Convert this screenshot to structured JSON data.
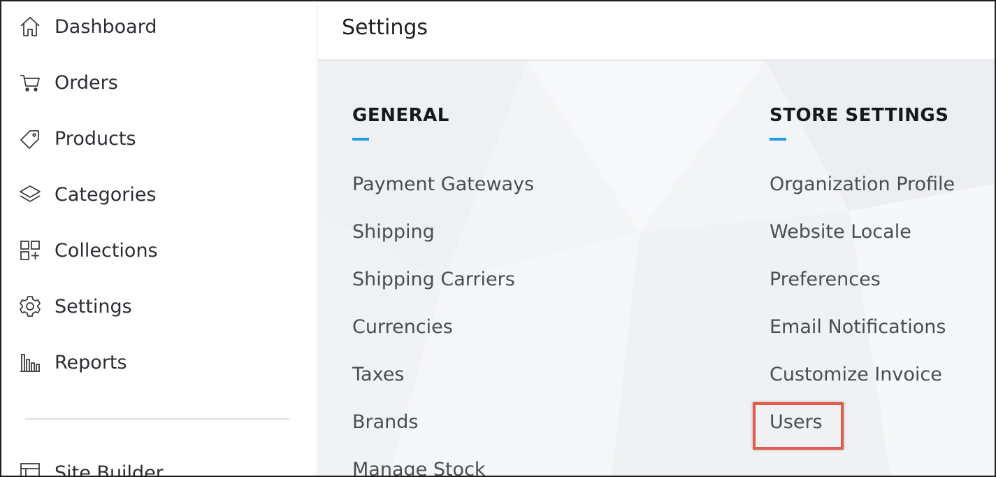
{
  "sidebar": {
    "items": [
      {
        "label": "Dashboard",
        "icon": "home-icon"
      },
      {
        "label": "Orders",
        "icon": "cart-icon"
      },
      {
        "label": "Products",
        "icon": "tag-icon"
      },
      {
        "label": "Categories",
        "icon": "layers-icon"
      },
      {
        "label": "Collections",
        "icon": "grid-plus-icon"
      },
      {
        "label": "Settings",
        "icon": "gear-icon"
      },
      {
        "label": "Reports",
        "icon": "bar-chart-icon"
      },
      {
        "label": "Site Builder",
        "icon": "window-icon"
      }
    ]
  },
  "header": {
    "title": "Settings"
  },
  "general": {
    "heading": "GENERAL",
    "links": [
      "Payment Gateways",
      "Shipping",
      "Shipping Carriers",
      "Currencies",
      "Taxes",
      "Brands",
      "Manage Stock"
    ]
  },
  "store_settings": {
    "heading": "STORE SETTINGS",
    "links": [
      "Organization Profile",
      "Website Locale",
      "Preferences",
      "Email Notifications",
      "Customize Invoice",
      "Users"
    ]
  },
  "colors": {
    "accent": "#1f9bea",
    "highlight": "#e45a4e"
  }
}
